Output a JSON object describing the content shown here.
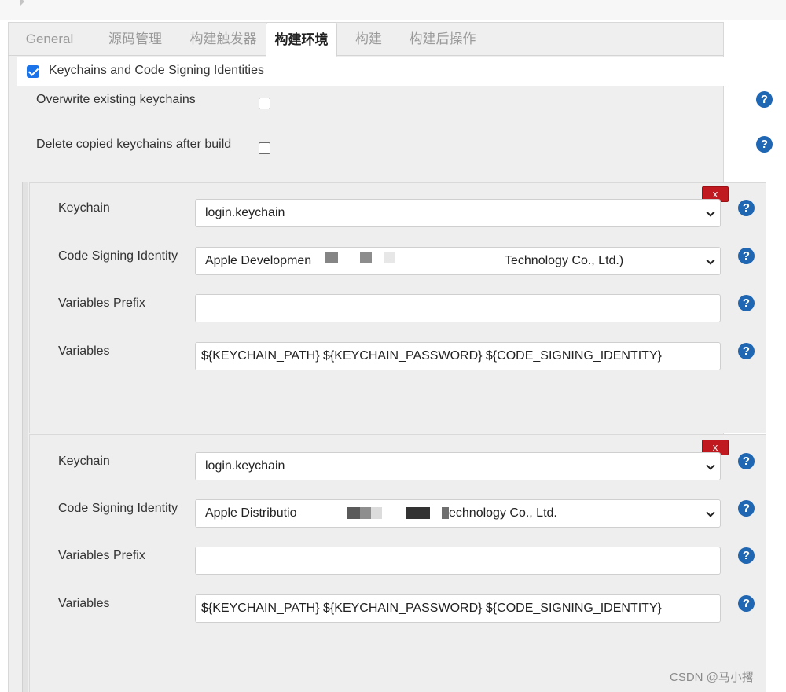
{
  "tabs": [
    {
      "label": "General",
      "active": false
    },
    {
      "label": "源码管理",
      "active": false
    },
    {
      "label": "构建触发器",
      "active": false
    },
    {
      "label": "构建环境",
      "active": true
    },
    {
      "label": "构建",
      "active": false
    },
    {
      "label": "构建后操作",
      "active": false
    }
  ],
  "section": {
    "title": "Keychains and Code Signing Identities",
    "checked": true
  },
  "options": {
    "overwrite_label": "Overwrite existing keychains",
    "delete_label": "Delete copied keychains after build"
  },
  "labels": {
    "keychain": "Keychain",
    "identity": "Code Signing Identity",
    "prefix": "Variables Prefix",
    "variables": "Variables",
    "delete": "x"
  },
  "blocks": [
    {
      "keychain": "login.keychain",
      "identity_prefix": "Apple Developmen",
      "identity_suffix": "Technology Co., Ltd.)",
      "variables_prefix": "",
      "variables": "${KEYCHAIN_PATH} ${KEYCHAIN_PASSWORD} ${CODE_SIGNING_IDENTITY}"
    },
    {
      "keychain": "login.keychain",
      "identity_prefix": "Apple Distributio",
      "identity_suffix": "echnology Co., Ltd.",
      "variables_prefix": "",
      "variables": "${KEYCHAIN_PATH} ${KEYCHAIN_PASSWORD} ${CODE_SIGNING_IDENTITY}"
    }
  ],
  "help_symbol": "?",
  "watermark": "CSDN @马小撂",
  "colors": {
    "accent": "#1a73e8",
    "help": "#1f66b3",
    "delete": "#c0191f"
  }
}
